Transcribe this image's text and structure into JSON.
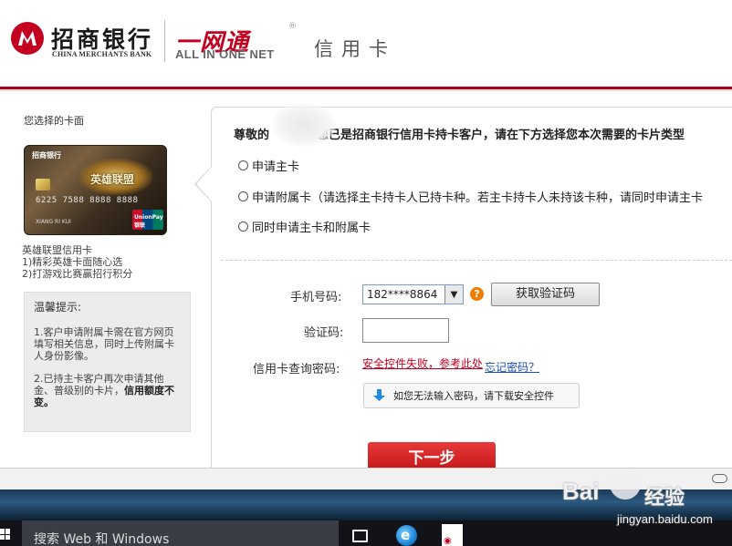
{
  "header": {
    "bank_name_cn": "招商银行",
    "bank_name_en": "CHINA MERCHANTS BANK",
    "brand_cn": "一网通",
    "brand_en": "ALL IN ONE NET",
    "brand_mark": "®",
    "section_title": "信用卡",
    "accent_color": "#c3001f"
  },
  "sidebar": {
    "title": "您选择的卡面",
    "card": {
      "bank": "招商银行",
      "logo_text": "英雄联盟",
      "number": "6225 7588 8888 8888",
      "holder": "XIANG RI KUI",
      "network": "UnionPay 银联"
    },
    "card_name": "英雄联盟信用卡",
    "card_feature_1": "1)精彩英雄卡面随心选",
    "card_feature_2": "2)打游戏比赛赢招行积分",
    "tips": {
      "title": "温馨提示:",
      "item_1": "1.客户申请附属卡需在官方网页填写相关信息，同时上传附属卡人身份影像。",
      "item_2_prefix": "2.已持主卡客户再次申请其他金、普级别的卡片，",
      "item_2_bold": "信用额度不变。"
    }
  },
  "form": {
    "headline_prefix": "尊敬的",
    "headline_suffix": "您已是招商银行信用卡持卡客户，请在下方选择您本次需要的卡片类型",
    "options": [
      {
        "label": "申请主卡"
      },
      {
        "label": "申请附属卡（请选择主卡持卡人已持卡种。若主卡持卡人未持该卡种，请同时申请主卡"
      },
      {
        "label": "同时申请主卡和附属卡"
      }
    ],
    "phone_label": "手机号码:",
    "phone_value": "182****8864",
    "help_icon_glyph": "?",
    "get_code_button": "获取验证码",
    "code_label": "验证码:",
    "code_value": "",
    "password_label": "信用卡查询密码:",
    "control_fail_link": "安全控件失败，参考此处",
    "forgot_password_link": "忘记密码？",
    "download_hint": "如您无法输入密码，请下载安全控件",
    "next_button": "下一步",
    "next_button_color": "#d62020"
  },
  "taskbar": {
    "search_placeholder": "搜索 Web 和 Windows"
  },
  "watermark": {
    "brand": "Bai",
    "brand_suffix": "经验",
    "url": "jingyan.baidu.com"
  }
}
